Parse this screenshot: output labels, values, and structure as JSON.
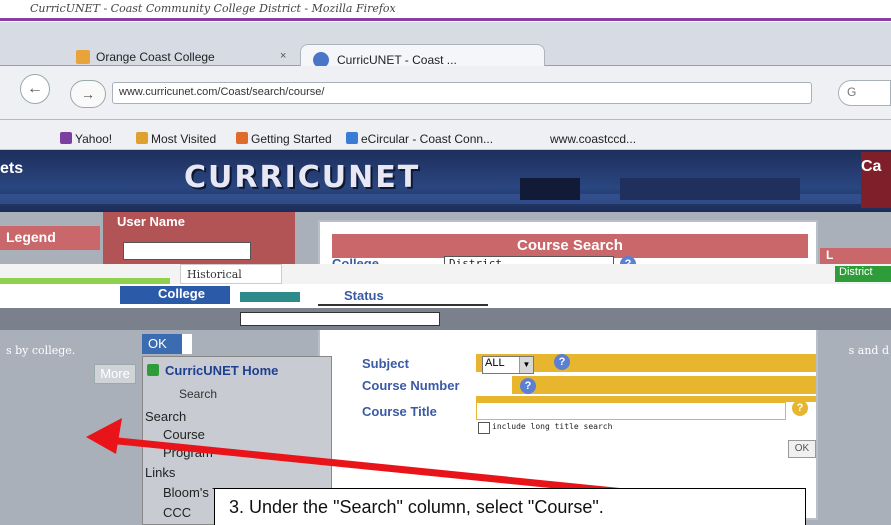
{
  "window": {
    "title": "CurricUNET - Coast Community College District - Mozilla Firefox"
  },
  "tabs": [
    {
      "label": "Orange Coast College",
      "close": "×"
    },
    {
      "label": "CurricUNET - Coast ..."
    }
  ],
  "navbar": {
    "back": "←",
    "forward": "→",
    "url": "www.curricunet.com/Coast/search/course/",
    "search_placeholder": "G"
  },
  "bookmarks": [
    {
      "label": "Yahoo!",
      "color": "#7b3fa0"
    },
    {
      "label": "Most Visited",
      "color": "#e0a030"
    },
    {
      "label": "Getting Started",
      "color": "#e06a2a"
    },
    {
      "label": "eCircular - Coast Conn...",
      "color": "#3a7bd5"
    },
    {
      "label": "www.coastccd...",
      "color": "#888"
    }
  ],
  "header": {
    "corner_left": "ets",
    "logo": "CURRICUNET",
    "corner_right": "Ca"
  },
  "sidebar": {
    "legend_title": "Legend",
    "legend_text": "s by college.",
    "more_button": "More"
  },
  "login": {
    "user_label": "User Name"
  },
  "strips": {
    "historical": "Historical",
    "district": "District",
    "college_tab": "College",
    "status_tab": "Status"
  },
  "course_search": {
    "title": "Course Search",
    "college_label": "College",
    "college_value": "District",
    "subject_label": "Subject",
    "subject_value": "ALL",
    "course_number_label": "Course Number",
    "course_title_label": "Course Title",
    "long_title_checkbox_label": "include long title search",
    "ok_button": "OK",
    "help": "?"
  },
  "nav": {
    "ok_button": "OK",
    "home_link": "CurricUNET Home",
    "home_search": "Search",
    "search_head": "Search",
    "course": "Course",
    "program": "Program",
    "links_head": "Links",
    "taxonomy": "Bloom's Taxonomy",
    "cc_link": "CCC"
  },
  "right_column": {
    "head": "L",
    "text": "s and d"
  },
  "annotation": {
    "callout": "3.  Under the \"Search\" column, select \"Course\".",
    "arrow_color": "#e8141a"
  }
}
